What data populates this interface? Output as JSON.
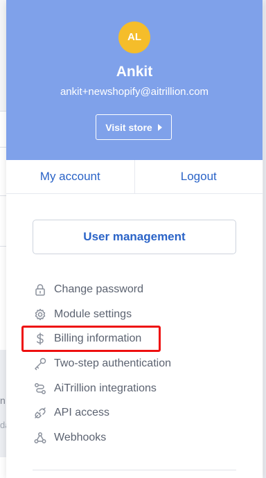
{
  "profile": {
    "initials": "AL",
    "name": "Ankit",
    "email": "ankit+newshopify@aitrillion.com",
    "visit_store_label": "Visit store"
  },
  "account_links": {
    "my_account": "My account",
    "logout": "Logout"
  },
  "user_management_label": "User management",
  "menu_items": [
    {
      "label": "Change password",
      "icon": "lock-icon"
    },
    {
      "label": "Module settings",
      "icon": "gear-icon"
    },
    {
      "label": "Billing information",
      "icon": "dollar-icon",
      "highlighted": true
    },
    {
      "label": "Two-step authentication",
      "icon": "key-icon"
    },
    {
      "label": "AiTrillion integrations",
      "icon": "integration-icon"
    },
    {
      "label": "API access",
      "icon": "plug-icon"
    },
    {
      "label": "Webhooks",
      "icon": "webhook-icon"
    }
  ],
  "colors": {
    "header_bg": "#7fa1ea",
    "avatar_bg": "#f5bd2a",
    "link": "#2a63c7",
    "highlight_border": "#ee0f0f"
  },
  "background_fragments": [
    "n",
    "da"
  ]
}
